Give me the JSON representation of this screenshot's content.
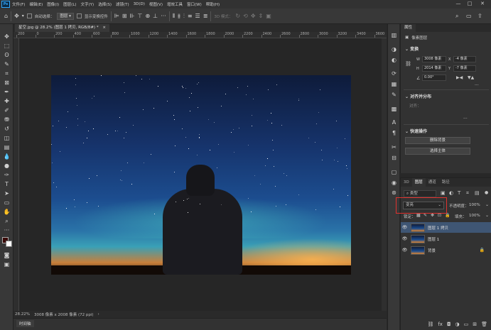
{
  "menu": {
    "logo": "Ps",
    "items": [
      "文件(F)",
      "编辑(E)",
      "图像(I)",
      "图层(L)",
      "文字(Y)",
      "选择(S)",
      "滤镜(T)",
      "3D(D)",
      "视图(V)",
      "增效工具",
      "窗口(W)",
      "帮助(H)"
    ],
    "window_buttons": [
      "—",
      "□",
      "✕"
    ]
  },
  "options": {
    "auto_select_label": "自动选择：",
    "auto_select_value": "图层",
    "show_transform_label": "显示变换控件",
    "mode_3d_label": "3D 模式："
  },
  "document": {
    "tab_label": "星空.jpg @ 28.2% (图层 1 拷贝, RGB/8#) *",
    "zoom": "28.22%",
    "doc_info": "3008 像素 x 2008 像素 (72 ppi)"
  },
  "ruler": {
    "ticks": [
      "200",
      "0",
      "200",
      "400",
      "600",
      "800",
      "1000",
      "1200",
      "1400",
      "1600",
      "1800",
      "2000",
      "2200",
      "2400",
      "2600",
      "2800",
      "3000",
      "3200",
      "3400",
      "3600"
    ]
  },
  "timeline": {
    "label": "时间轴"
  },
  "properties": {
    "tab": "属性",
    "doc_type": "像素图层",
    "transform_title": "变换",
    "w_label": "W",
    "w_value": "3008 像素",
    "x_label": "X",
    "x_value": "-4 像素",
    "h_label": "H",
    "h_value": "2014 像素",
    "y_label": "Y",
    "y_value": "-7 像素",
    "angle_value": "0.00°",
    "align_title": "对齐并分布",
    "align_label": "对齐：",
    "quick_title": "快速操作",
    "remove_bg": "删除背景",
    "select_subject": "选择主体"
  },
  "layers": {
    "tabs": [
      "3D",
      "图层",
      "通道",
      "路径"
    ],
    "active_tab": "图层",
    "kind_filter": "类型",
    "blend_mode": "变亮",
    "opacity_label": "不透明度：",
    "opacity_value": "100%",
    "lock_label": "锁定：",
    "fill_label": "填充：",
    "fill_value": "100%",
    "rows": [
      {
        "name": "图层 1 拷贝",
        "selected": true
      },
      {
        "name": "图层 1",
        "selected": false
      },
      {
        "name": "背景",
        "selected": false
      }
    ]
  },
  "colors": {
    "accent": "#31a8ff",
    "highlight": "#e0322e",
    "selected_row": "#3f5674"
  }
}
